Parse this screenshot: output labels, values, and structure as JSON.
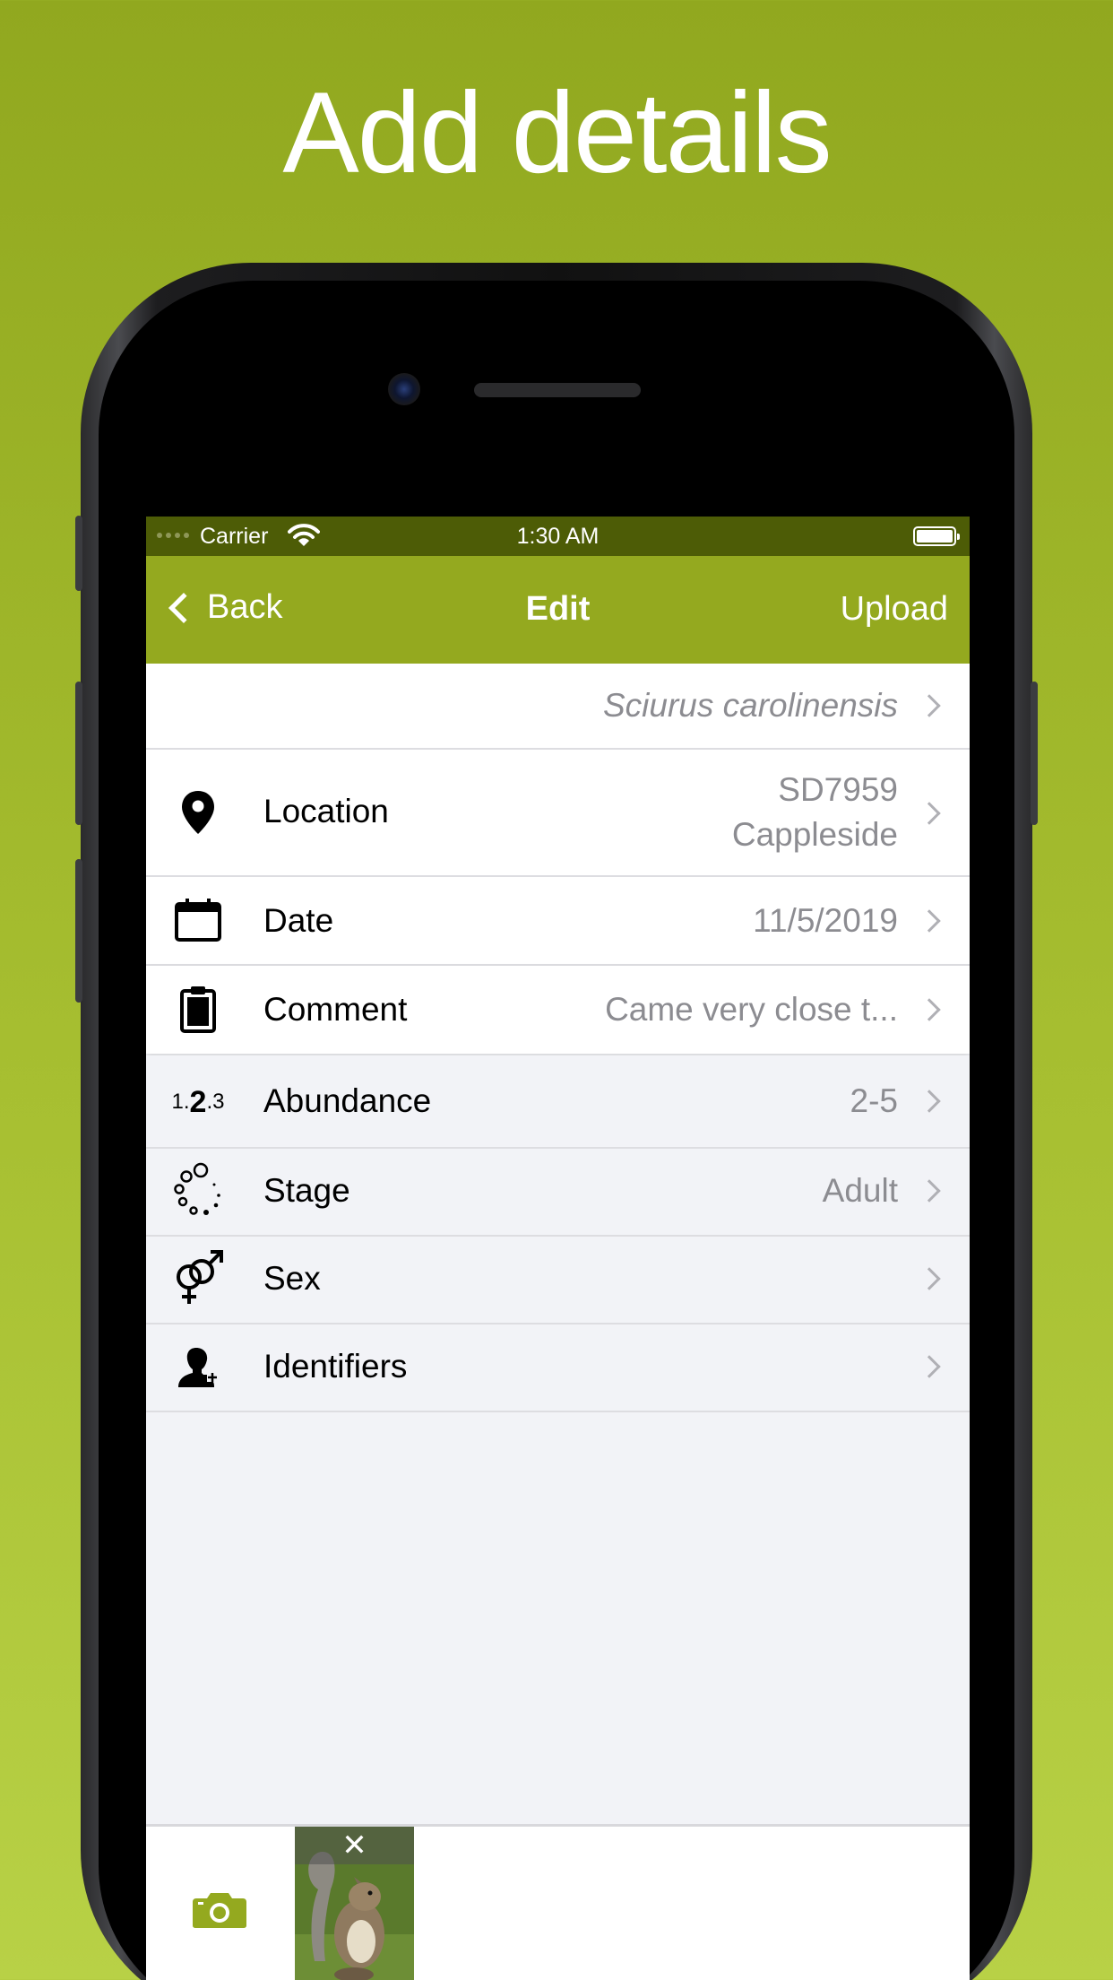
{
  "headline": "Add details",
  "status_bar": {
    "carrier": "Carrier",
    "time": "1:30 AM"
  },
  "nav": {
    "back_label": "Back",
    "title": "Edit",
    "upload_label": "Upload"
  },
  "rows": {
    "species": {
      "value": "Sciurus carolinensis"
    },
    "location": {
      "label": "Location",
      "value_line1": "SD7959",
      "value_line2": "Cappleside",
      "icon": "location-pin-icon"
    },
    "date": {
      "label": "Date",
      "value": "11/5/2019",
      "icon": "calendar-icon"
    },
    "comment": {
      "label": "Comment",
      "value": "Came very close t...",
      "icon": "clipboard-icon"
    },
    "abundance": {
      "label": "Abundance",
      "value": "2-5",
      "icon": "abundance-123-icon",
      "icon_text_1": "1.",
      "icon_text_2": "2",
      "icon_text_3": ".3"
    },
    "stage": {
      "label": "Stage",
      "value": "Adult",
      "icon": "stage-circles-icon"
    },
    "sex": {
      "label": "Sex",
      "value": "",
      "icon": "gender-symbols-icon"
    },
    "identifiers": {
      "label": "Identifiers",
      "value": "",
      "icon": "person-add-icon"
    }
  },
  "bottom": {
    "camera_icon": "camera-icon",
    "photo_close": "✕"
  },
  "colors": {
    "background_top": "#91a81f",
    "background_bottom": "#b8d146",
    "nav_bar": "#94a91f",
    "status_bar": "#4d5c06",
    "accent": "#94a91f"
  }
}
